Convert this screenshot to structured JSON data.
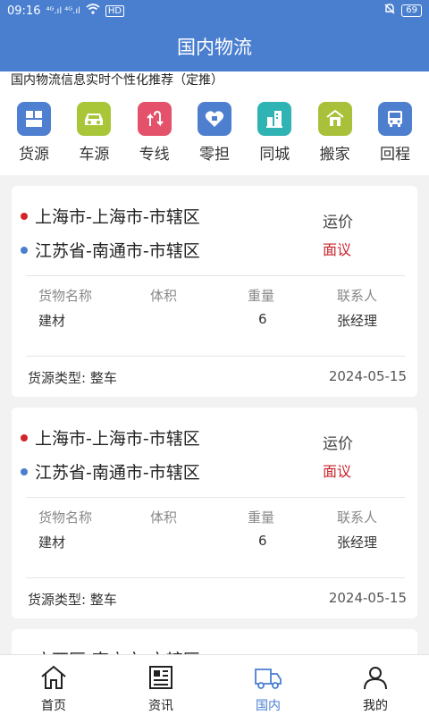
{
  "status": {
    "time": "09:16",
    "network": "⁴ᴳ.ıl ⁴ᴳ.ıl",
    "wifi_hd": "HD",
    "battery": "69"
  },
  "header": {
    "title": "国内物流"
  },
  "subtitle": "国内物流信息实时个性化推荐（定推）",
  "categories": [
    {
      "label": "货源",
      "icon": "goods-icon",
      "color": "#4f7fd0"
    },
    {
      "label": "车源",
      "icon": "car-icon",
      "color": "#a8c637"
    },
    {
      "label": "专线",
      "icon": "route-icon",
      "color": "#e3526a"
    },
    {
      "label": "零担",
      "icon": "heart-box-icon",
      "color": "#4e7fcf"
    },
    {
      "label": "同城",
      "icon": "city-icon",
      "color": "#2fb3b3"
    },
    {
      "label": "搬家",
      "icon": "moving-icon",
      "color": "#a9c13a"
    },
    {
      "label": "回程",
      "icon": "bus-icon",
      "color": "#4e7fcf"
    }
  ],
  "cards": [
    {
      "from": "上海市-上海市-市辖区",
      "to": "江苏省-南通市-市辖区",
      "price_label": "运价",
      "price_value": "面议",
      "headers": [
        "货物名称",
        "体积",
        "重量",
        "联系人"
      ],
      "values": [
        "建材",
        "",
        "6",
        "张经理"
      ],
      "type": "货源类型: 整车",
      "date": "2024-05-15"
    },
    {
      "from": "上海市-上海市-市辖区",
      "to": "江苏省-南通市-市辖区",
      "price_label": "运价",
      "price_value": "面议",
      "headers": [
        "货物名称",
        "体积",
        "重量",
        "联系人"
      ],
      "values": [
        "建材",
        "",
        "6",
        "张经理"
      ],
      "type": "货源类型: 整车",
      "date": "2024-05-15"
    }
  ],
  "partial_card": {
    "from": "广西区-南宁市-市辖区"
  },
  "tabs": [
    {
      "label": "首页",
      "icon": "home-icon"
    },
    {
      "label": "资讯",
      "icon": "news-icon"
    },
    {
      "label": "国内",
      "icon": "truck-icon"
    },
    {
      "label": "我的",
      "icon": "user-icon"
    }
  ],
  "colors": {
    "primary": "#4a7fd0",
    "price": "#c8232c",
    "dot_from": "#d4242b",
    "dot_to": "#4a7fd0"
  }
}
